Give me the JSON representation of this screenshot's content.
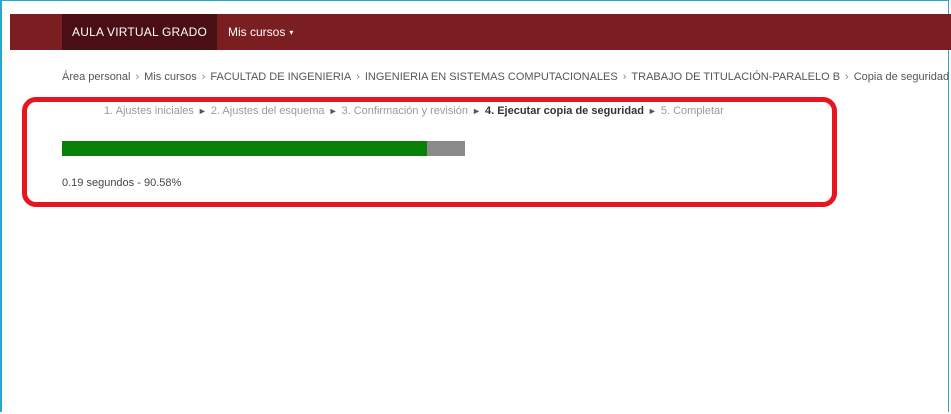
{
  "navbar": {
    "brand": "AULA VIRTUAL GRADO",
    "menu_label": "Mis cursos",
    "menu_caret": "▾"
  },
  "breadcrumb": {
    "separator": "›",
    "items": [
      "Área personal",
      "Mis cursos",
      "FACULTAD DE INGENIERIA",
      "INGENIERIA EN SISTEMAS COMPUTACIONALES",
      "TRABAJO DE TITULACIÓN-PARALELO B",
      "Copia de seguridad"
    ]
  },
  "steps": {
    "arrow": "►",
    "items": [
      "1. Ajustes iniciales",
      "2. Ajustes del esquema",
      "3. Confirmación y revisión",
      "4. Ejecutar copia de seguridad",
      "5. Completar"
    ],
    "current_index": 3
  },
  "progress": {
    "percent": 90.58,
    "fill_color": "#078007",
    "track_color": "#8a8a8a",
    "status_text": "0.19 segundos - 90.58%"
  },
  "colors": {
    "navbar": "#7b1e22",
    "brand_bg": "#4a0f14",
    "highlight": "#e8141e"
  }
}
